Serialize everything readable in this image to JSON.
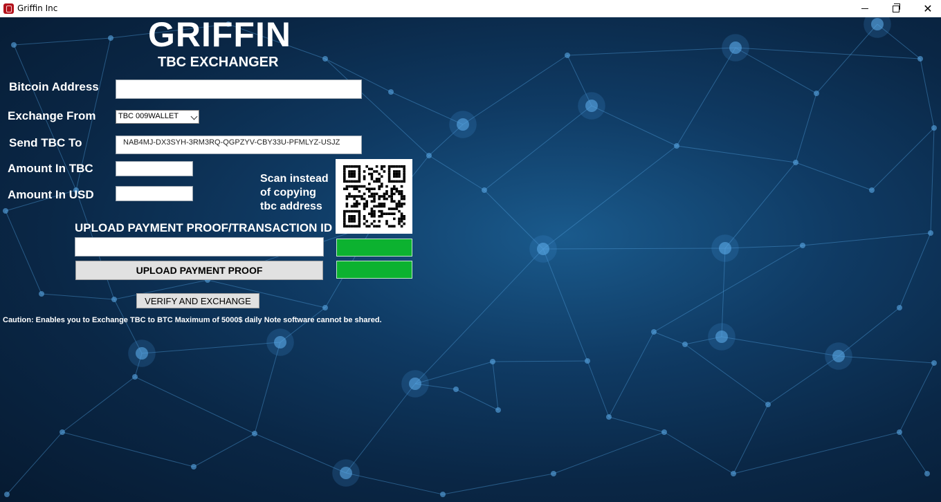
{
  "window": {
    "title": "Griffin Inc",
    "icon": "griffin-app-icon",
    "controls": {
      "minimize": "minimize-icon",
      "maximize": "restore-icon",
      "close": "✕"
    }
  },
  "header": {
    "title": "GRIFFIN",
    "subtitle": "TBC EXCHANGER"
  },
  "form": {
    "bitcoin_address": {
      "label": "Bitcoin Address",
      "value": ""
    },
    "exchange_from": {
      "label": "Exchange From",
      "selected": "TBC 009WALLET"
    },
    "send_tbc_to": {
      "label": "Send TBC To",
      "value": "NAB4MJ-DX3SYH-3RM3RQ-QGPZYV-CBY33U-PFMLYZ-USJZ"
    },
    "amount_tbc": {
      "label": "Amount In TBC",
      "value": ""
    },
    "amount_usd": {
      "label": "Amount In USD",
      "value": ""
    }
  },
  "qr": {
    "line1": "Scan instead",
    "line2": "of copying",
    "line3": "tbc address",
    "icon": "qr-code-icon"
  },
  "upload": {
    "heading": "UPLOAD PAYMENT PROOF/TRANSACTION ID",
    "transaction_value": "",
    "button_label": "UPLOAD PAYMENT PROOF"
  },
  "actions": {
    "verify_label": "VERIFY AND EXCHANGE"
  },
  "caution": "Caution: Enables you to Exchange TBC to BTC Maximum of 5000$ daily Note software cannot be shared.",
  "colors": {
    "background": "#0a2746",
    "status_green": "#0cb230",
    "button_gray": "#e1e1e1"
  }
}
